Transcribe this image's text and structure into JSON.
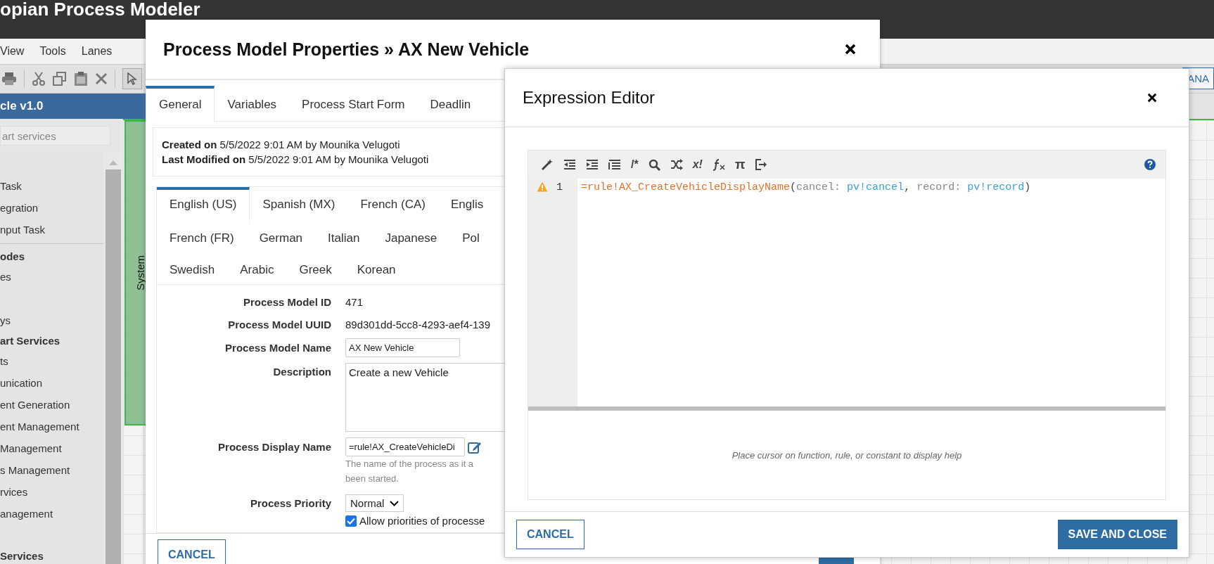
{
  "app_title": "opian Process Modeler",
  "menu": [
    "View",
    "Tools",
    "Lanes"
  ],
  "model_title": "cle v1.0",
  "palette": {
    "search_placeholder": "art services",
    "items": [
      {
        "kind": "item",
        "text": "Task"
      },
      {
        "kind": "item",
        "text": "egration"
      },
      {
        "kind": "item",
        "text": "nput Task"
      },
      {
        "kind": "divider"
      },
      {
        "kind": "header",
        "text": "odes"
      },
      {
        "kind": "item",
        "text": "es"
      },
      {
        "kind": "gap"
      },
      {
        "kind": "item",
        "text": "ys"
      },
      {
        "kind": "header",
        "text": "art Services"
      },
      {
        "kind": "item",
        "text": "ts"
      },
      {
        "kind": "item",
        "text": "unication"
      },
      {
        "kind": "item",
        "text": "ent Generation"
      },
      {
        "kind": "item",
        "text": "ent Management"
      },
      {
        "kind": "item",
        "text": "Management"
      },
      {
        "kind": "item",
        "text": "s Management"
      },
      {
        "kind": "item",
        "text": "rvices"
      },
      {
        "kind": "item",
        "text": "anagement"
      },
      {
        "kind": "gap"
      },
      {
        "kind": "header",
        "text": "Services"
      }
    ]
  },
  "lane": {
    "label": "System"
  },
  "canvas_toolbar": {
    "button": "ANA"
  },
  "properties_dialog": {
    "title": "Process Model Properties » AX New Vehicle",
    "tabs": [
      {
        "label": "General",
        "selected": true
      },
      {
        "label": "Variables",
        "selected": false
      },
      {
        "label": "Process Start Form",
        "selected": false
      },
      {
        "label": "Deadlin",
        "selected": false
      }
    ],
    "info": [
      {
        "label": "Created on",
        "value": "5/5/2022 9:01 AM by Mounika Velugoti"
      },
      {
        "label": "Last Modified on",
        "value": "5/5/2022 9:01 AM by Mounika Velugoti"
      }
    ],
    "language_rows": [
      [
        {
          "label": "English (US)",
          "selected": true
        },
        {
          "label": "Spanish (MX)",
          "selected": false
        },
        {
          "label": "French (CA)",
          "selected": false
        },
        {
          "label": "Englis",
          "selected": false
        }
      ],
      [
        {
          "label": "French (FR)",
          "selected": false
        },
        {
          "label": "German",
          "selected": false
        },
        {
          "label": "Italian",
          "selected": false
        },
        {
          "label": "Japanese",
          "selected": false
        },
        {
          "label": "Pol",
          "selected": false
        }
      ],
      [
        {
          "label": "Swedish",
          "selected": false
        },
        {
          "label": "Arabic",
          "selected": false
        },
        {
          "label": "Greek",
          "selected": false
        },
        {
          "label": "Korean",
          "selected": false
        }
      ]
    ],
    "fields": [
      {
        "kind": "text",
        "label": "Process Model ID",
        "value": "471"
      },
      {
        "kind": "text",
        "label": "Process Model UUID",
        "value": "89d301dd-5cc8-4293-aef4-139"
      },
      {
        "kind": "input",
        "label": "Process Model Name",
        "value": "AX New Vehicle"
      },
      {
        "kind": "textarea",
        "label": "Description",
        "value": "Create a new Vehicle"
      },
      {
        "kind": "expression",
        "label": "Process Display Name",
        "value": "=rule!AX_CreateVehicleDi",
        "hint_lines": [
          "The name of the process as it a",
          "been started."
        ]
      },
      {
        "kind": "select",
        "label": "Process Priority",
        "value": "Normal",
        "checkbox": {
          "label": "Allow priorities of processe",
          "checked": true
        }
      }
    ],
    "cancel_button": "CANCEL"
  },
  "expression_editor": {
    "title": "Expression Editor",
    "toolbar_texts": [
      "/*",
      "x!",
      "π"
    ],
    "line_number": "1",
    "warning": true,
    "tokens": [
      {
        "kind": "rule",
        "text": "=rule!AX_CreateVehicleDisplayName"
      },
      {
        "kind": "punct",
        "text": "("
      },
      {
        "kind": "param",
        "text": "cancel:"
      },
      {
        "kind": "variable",
        "text": "pv!cancel"
      },
      {
        "kind": "punct",
        "text": ","
      },
      {
        "kind": "param",
        "text": "record:"
      },
      {
        "kind": "variable",
        "text": "pv!record"
      },
      {
        "kind": "punct",
        "text": ")"
      }
    ],
    "help_text": "Place cursor on function, rule, or constant to display help",
    "buttons": [
      {
        "kind": "secondary",
        "label": "CANCEL"
      },
      {
        "kind": "primary",
        "label": "SAVE AND CLOSE"
      }
    ]
  }
}
